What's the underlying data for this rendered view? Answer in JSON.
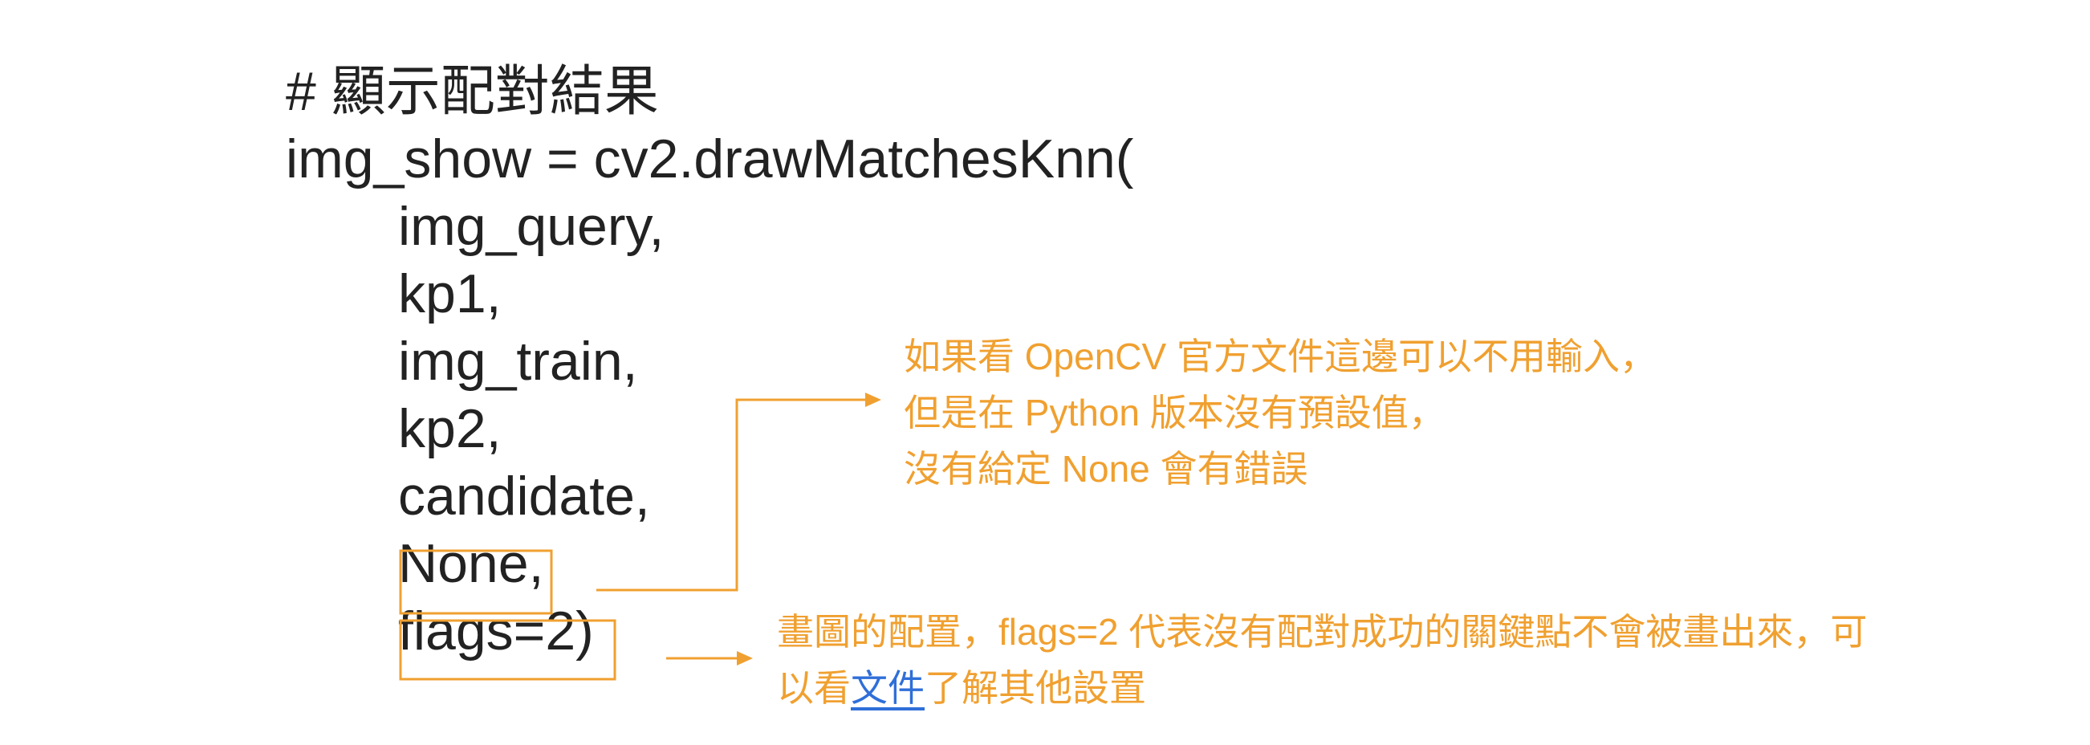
{
  "code": {
    "comment": "# 顯示配對結果",
    "call": "img_show = cv2.drawMatchesKnn(",
    "args": [
      "img_query,",
      "kp1,",
      "img_train,",
      "kp2,",
      "candidate,",
      "None,",
      "flags=2)"
    ]
  },
  "annotations": {
    "none_note": [
      "如果看 OpenCV 官方文件這邊可以不用輸入，",
      "但是在 Python 版本沒有預設值，",
      "沒有給定 None 會有錯誤"
    ],
    "flags_note_line1": "畫圖的配置，flags=2 代表沒有配對成功的關鍵點不會被畫出來，可",
    "flags_note_line2_before": "以看",
    "flags_note_link": "文件",
    "flags_note_line2_after": "了解其他設置"
  },
  "colors": {
    "annotation": "#f0a030",
    "code_text": "#222222",
    "link": "#2f6fd8",
    "background": "#ffffff"
  }
}
